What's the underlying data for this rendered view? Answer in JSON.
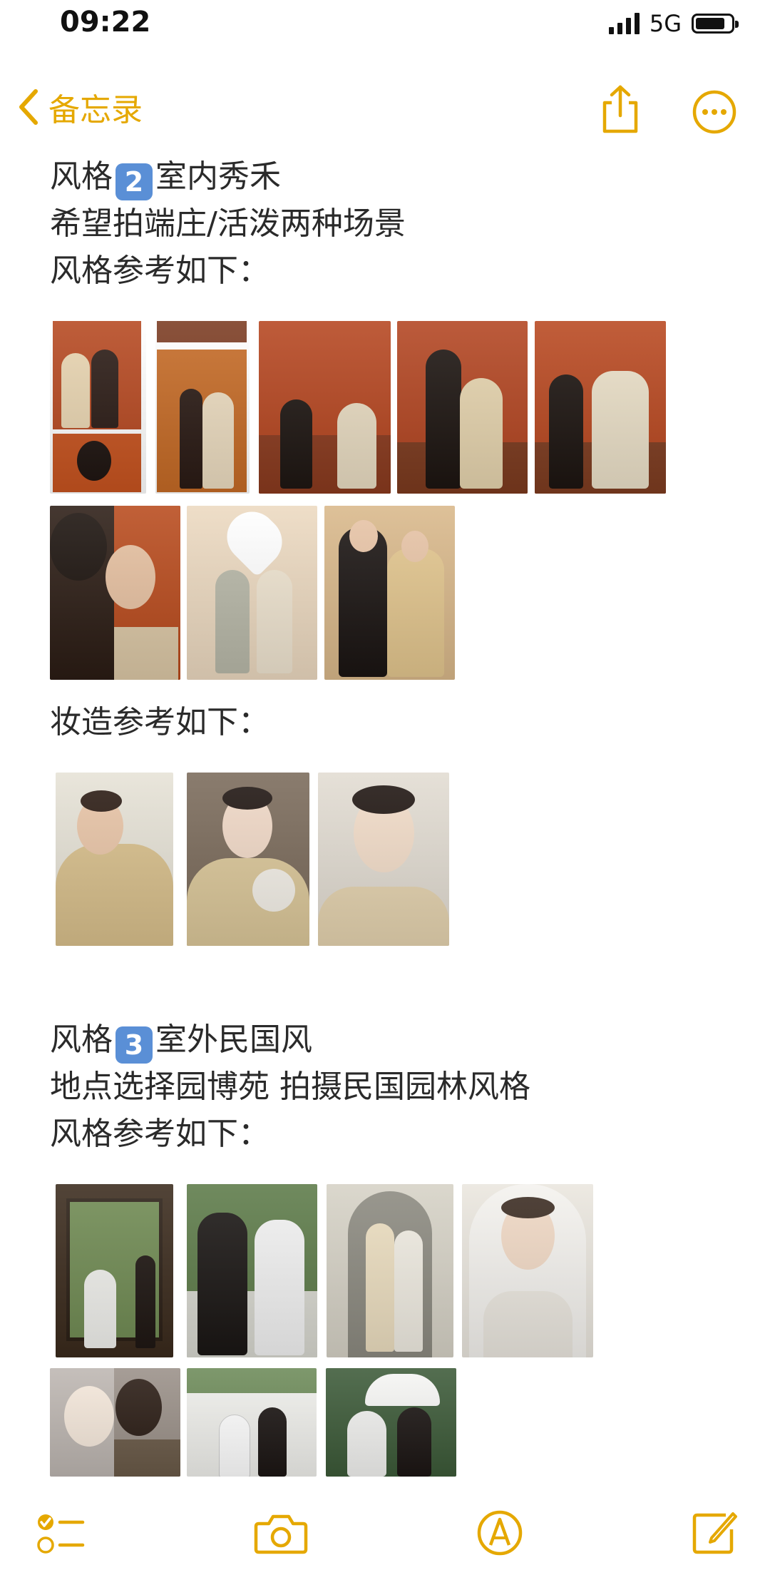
{
  "status": {
    "time": "09:22",
    "network": "5G"
  },
  "nav": {
    "back_label": "备忘录"
  },
  "note": {
    "s2": {
      "prefix": "风格",
      "num": "2",
      "title": "室内秀禾"
    },
    "s2_line2": "希望拍端庄/活泼两种场景",
    "s2_style_ref": "风格参考如下：",
    "makeup_ref": "妆造参考如下：",
    "s3": {
      "prefix": "风格",
      "num": "3",
      "title": "室外民国风"
    },
    "s3_line2": "地点选择园博苑 拍摄民国园林风格",
    "s3_style_ref": "风格参考如下："
  },
  "colors": {
    "accent": "#e5a800",
    "badge": "#5a8fd6"
  },
  "icons": [
    "chevron-left-icon",
    "share-icon",
    "more-icon",
    "checklist-icon",
    "camera-icon",
    "markup-icon",
    "compose-icon"
  ]
}
